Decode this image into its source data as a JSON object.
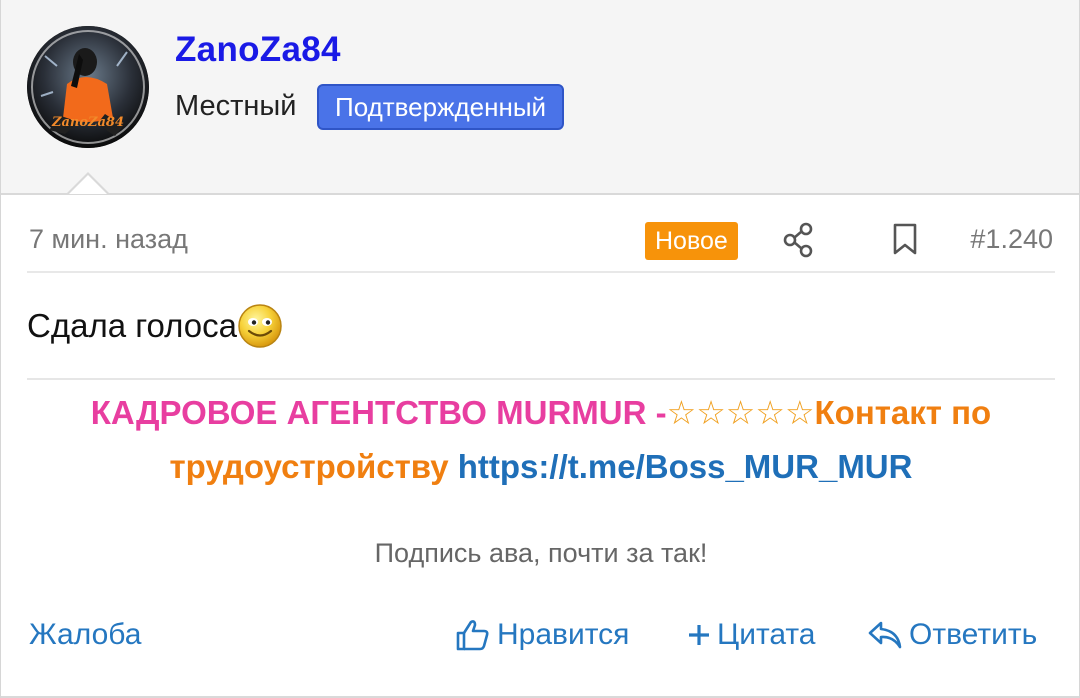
{
  "user": {
    "name": "ZanoZa84",
    "rank": "Местный",
    "badge": "Подтвержденный",
    "avatar_icon": "avatar-image",
    "avatar_text": "ZanoZa84"
  },
  "meta": {
    "time": "7 мин. назад",
    "new_badge": "Новое",
    "post_number": "#1.240",
    "share_icon": "share-icon",
    "bookmark_icon": "bookmark-icon"
  },
  "post": {
    "message": "Сдала голоса",
    "emoji_icon": "smiley-icon"
  },
  "signature": {
    "part1": "КАДРОВОЕ АГЕНТСТВО MURMUR -",
    "stars": "☆☆☆☆☆",
    "part2": "Контакт по трудоустройству",
    "link": "https://t.me/Boss_MUR_MUR",
    "caption": "Подпись ава, почти за так!"
  },
  "actions": {
    "report": "Жалоба",
    "like": "Нравится",
    "quote": "Цитата",
    "reply": "Ответить"
  },
  "colors": {
    "username": "#1a1ae6",
    "badge": "#4a73e8",
    "new_badge": "#f7930a",
    "link": "#1f6fb8",
    "signature_pink": "#e83ea0",
    "signature_orange": "#f07f10",
    "action": "#2577c0"
  }
}
